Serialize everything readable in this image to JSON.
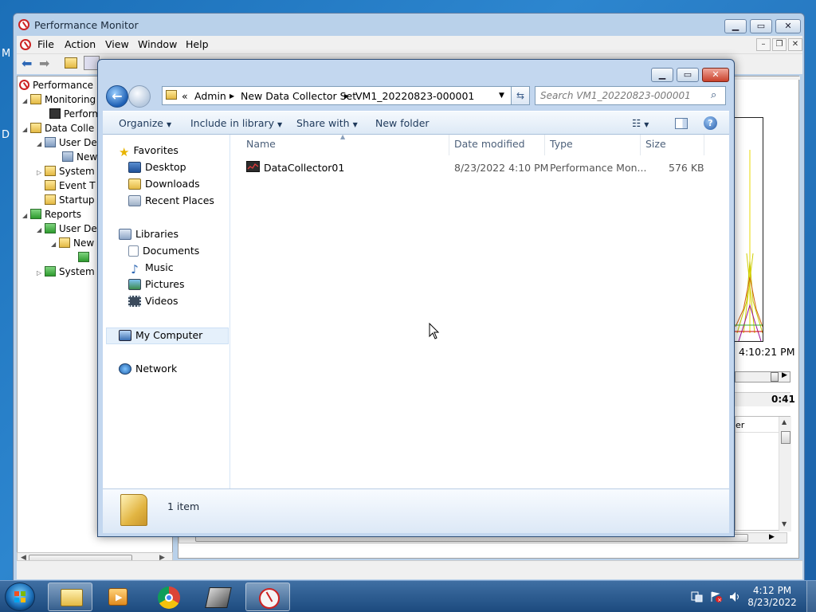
{
  "desktop": {
    "frag_m": "M",
    "frag_d": "D"
  },
  "perfmon": {
    "title": "Performance Monitor",
    "menu": [
      "File",
      "Action",
      "View",
      "Window",
      "Help"
    ],
    "tree": [
      "Performance",
      "Monitoring",
      "Perform",
      "Data Colle",
      "User De",
      "New",
      "System",
      "Event T",
      "Startup",
      "Reports",
      "User De",
      "New",
      "System"
    ],
    "time_label": "4:10:21 PM",
    "duration": "0:41",
    "col_fragment": "er"
  },
  "explorer": {
    "breadcrumb_prefix": "«",
    "breadcrumb": [
      "Admin",
      "New Data Collector Set",
      "VM1_20220823-000001"
    ],
    "search_placeholder": "Search VM1_20220823-000001",
    "commands": {
      "organize": "Organize",
      "include": "Include in library",
      "share": "Share with",
      "new_folder": "New folder"
    },
    "nav": {
      "favorites": "Favorites",
      "favorite_items": [
        "Desktop",
        "Downloads",
        "Recent Places"
      ],
      "libraries": "Libraries",
      "library_items": [
        "Documents",
        "Music",
        "Pictures",
        "Videos"
      ],
      "computer": "My Computer",
      "network": "Network"
    },
    "columns": {
      "name": "Name",
      "date": "Date modified",
      "type": "Type",
      "size": "Size"
    },
    "files": [
      {
        "name": "DataCollector01",
        "date": "8/23/2022 4:10 PM",
        "type": "Performance Mon...",
        "size": "576 KB"
      }
    ],
    "details": "1 item"
  },
  "taskbar": {
    "time": "4:12 PM",
    "date": "8/23/2022"
  }
}
